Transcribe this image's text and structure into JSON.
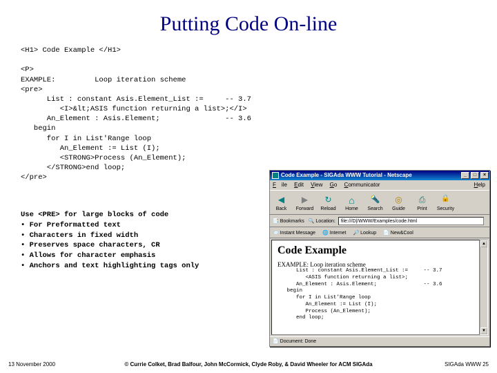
{
  "title": "Putting Code On-line",
  "source": {
    "line1": "<H1> Code Example </H1>",
    "line3": "<P>",
    "line4": "EXAMPLE:         Loop iteration scheme",
    "line5": "<pre>",
    "line6": "      List : constant Asis.Element_List :=     -- 3.7",
    "line7": "         <I>&lt;ASIS function returning a list>;</I>",
    "line8": "      An_Element : Asis.Element;               -- 3.6",
    "line9": "   begin",
    "line10": "      for I in List'Range loop",
    "line11": "         An_Element := List (I);",
    "line12": "         <STRONG>Process (An_Element);",
    "line13": "      </STRONG>end loop;",
    "line14": "</pre>"
  },
  "desc": {
    "heading": "Use <PRE> for large blocks of code",
    "b1": "• For Preformatted text",
    "b2": "• Characters in fixed width",
    "b3": "• Preserves space characters, CR",
    "b4": "• Allows for character emphasis",
    "b5": "• Anchors and text highlighting tags only"
  },
  "footer": {
    "date": "13 November 2000",
    "credits": "© Currie Colket, Brad Balfour, John McCormick, Clyde Roby, & David Wheeler for ACM SIGAda",
    "page": "SIGAda WWW 25"
  },
  "browser": {
    "title": "Code Example - SIGAda WWW Tutorial - Netscape",
    "menu": {
      "file": "File",
      "edit": "Edit",
      "view": "View",
      "go": "Go",
      "comm": "Communicator",
      "help": "Help"
    },
    "toolbar": {
      "back": "Back",
      "fwd": "Forward",
      "reload": "Reload",
      "home": "Home",
      "search": "Search",
      "guide": "Guide",
      "print": "Print",
      "security": "Security"
    },
    "loc": {
      "bookmarks": "Bookmarks",
      "label": "Location:",
      "value": "file:///D|/WWW/Examples/code.html"
    },
    "quick": {
      "msg": "Instant Message",
      "int": "Internet",
      "lookup": "Lookup",
      "newcool": "New&Cool"
    },
    "page": {
      "h1": "Code Example",
      "sub": "EXAMPLE: Loop iteration scheme",
      "pre": "      List : constant Asis.Element_List :=     -- 3.7\n         <ASIS function returning a list>;\n      An_Element : Asis.Element;               -- 3.6\n   begin\n      for I in List'Range loop\n         An_Element := List (I);\n         Process (An_Element);\n      end loop;"
    },
    "status": "Document: Done"
  }
}
